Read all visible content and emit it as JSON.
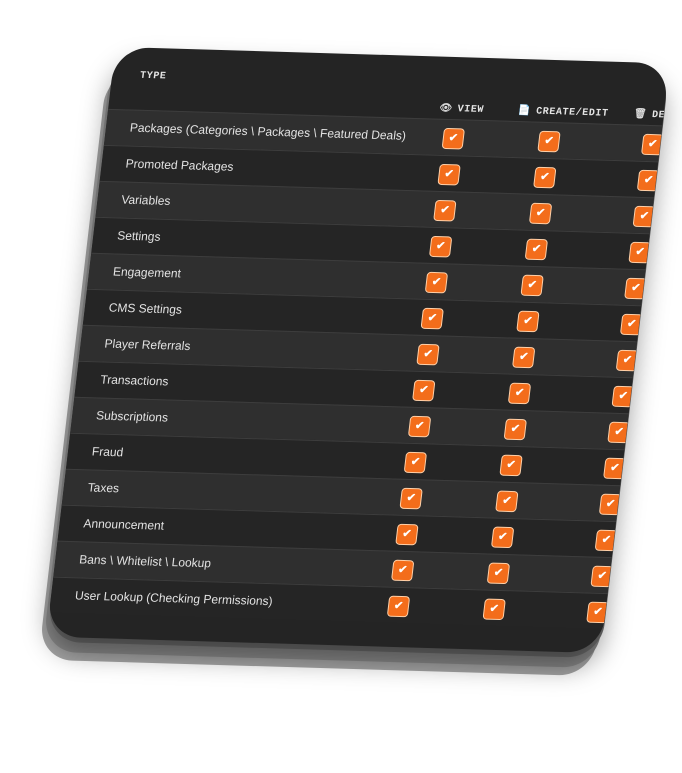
{
  "header": {
    "type": "TYPE",
    "view": "VIEW",
    "create_edit": "CREATE/EDIT",
    "delete": "DELETE",
    "icons": {
      "view": "eye-icon",
      "create_edit": "document-icon",
      "delete": "trash-icon"
    }
  },
  "check_glyph": "✔",
  "colors": {
    "checkbox": "#f36d1b",
    "card": "#242424"
  },
  "rows": [
    {
      "label": "Packages (Categories \\ Packages \\ Featured Deals)",
      "view": true,
      "create_edit": true,
      "delete": true
    },
    {
      "label": "Promoted Packages",
      "view": true,
      "create_edit": true,
      "delete": true
    },
    {
      "label": "Variables",
      "view": true,
      "create_edit": true,
      "delete": true
    },
    {
      "label": "Settings",
      "view": true,
      "create_edit": true,
      "delete": true
    },
    {
      "label": "Engagement",
      "view": true,
      "create_edit": true,
      "delete": true
    },
    {
      "label": "CMS Settings",
      "view": true,
      "create_edit": true,
      "delete": true
    },
    {
      "label": "Player Referrals",
      "view": true,
      "create_edit": true,
      "delete": true
    },
    {
      "label": "Transactions",
      "view": true,
      "create_edit": true,
      "delete": true
    },
    {
      "label": "Subscriptions",
      "view": true,
      "create_edit": true,
      "delete": true
    },
    {
      "label": "Fraud",
      "view": true,
      "create_edit": true,
      "delete": true
    },
    {
      "label": "Taxes",
      "view": true,
      "create_edit": true,
      "delete": true
    },
    {
      "label": "Announcement",
      "view": true,
      "create_edit": true,
      "delete": true
    },
    {
      "label": "Bans \\ Whitelist \\ Lookup",
      "view": true,
      "create_edit": true,
      "delete": true
    },
    {
      "label": "User Lookup (Checking Permissions)",
      "view": true,
      "create_edit": true,
      "delete": true
    }
  ]
}
